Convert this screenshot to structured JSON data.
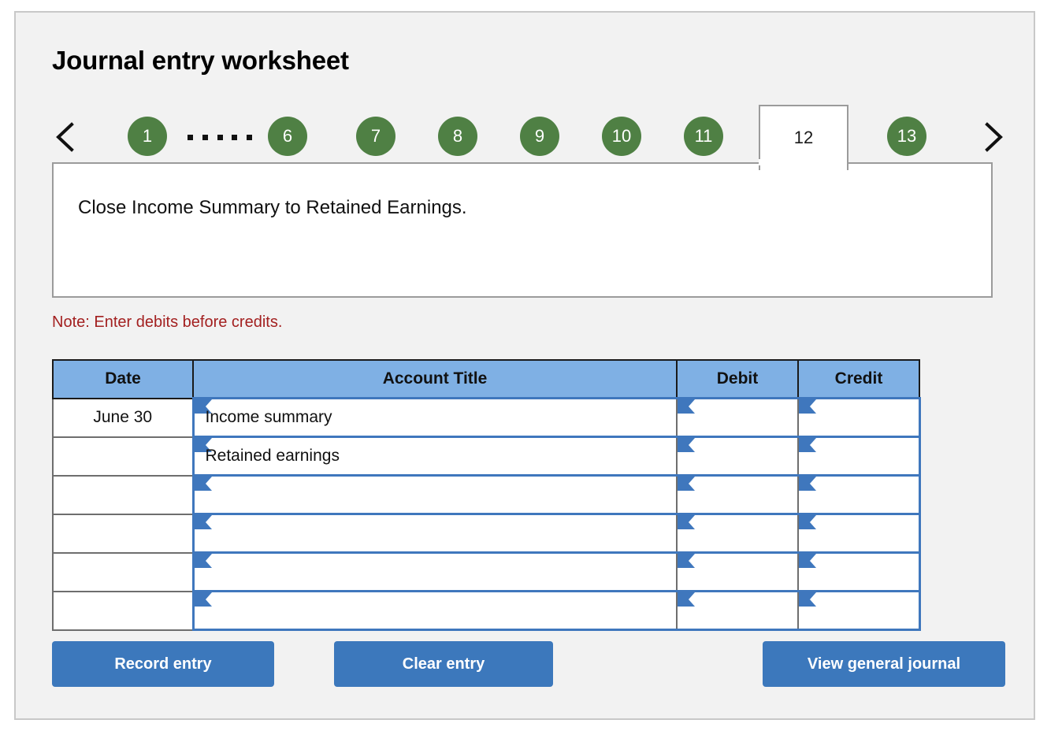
{
  "page_title": "Journal entry worksheet",
  "pager": {
    "prev_icon": "chevron-left-icon",
    "next_icon": "chevron-right-icon",
    "ellipsis": ".....",
    "items": [
      {
        "label": "1",
        "active": false
      },
      {
        "label": "6",
        "active": false
      },
      {
        "label": "7",
        "active": false
      },
      {
        "label": "8",
        "active": false
      },
      {
        "label": "9",
        "active": false
      },
      {
        "label": "10",
        "active": false
      },
      {
        "label": "11",
        "active": false
      },
      {
        "label": "12",
        "active": true
      },
      {
        "label": "13",
        "active": false
      }
    ],
    "active_label": "12"
  },
  "scenario": {
    "text": "Close Income Summary to Retained Earnings."
  },
  "note": "Note: Enter debits before credits.",
  "table": {
    "headers": [
      "Date",
      "Account Title",
      "Debit",
      "Credit"
    ],
    "rows": [
      {
        "date": "June 30",
        "account": "Income summary",
        "debit": "",
        "credit": ""
      },
      {
        "date": "",
        "account": "Retained earnings",
        "debit": "",
        "credit": ""
      },
      {
        "date": "",
        "account": "",
        "debit": "",
        "credit": ""
      },
      {
        "date": "",
        "account": "",
        "debit": "",
        "credit": ""
      },
      {
        "date": "",
        "account": "",
        "debit": "",
        "credit": ""
      },
      {
        "date": "",
        "account": "",
        "debit": "",
        "credit": ""
      }
    ]
  },
  "buttons": {
    "record": "Record entry",
    "clear": "Clear entry",
    "journal": "View general journal"
  },
  "colors": {
    "pager_green": "#4f8044",
    "header_blue": "#7fb0e4",
    "field_blue": "#3f77bd",
    "button_blue": "#3c78bc",
    "note_red": "#a32020",
    "panel_grey": "#f2f2f2"
  }
}
